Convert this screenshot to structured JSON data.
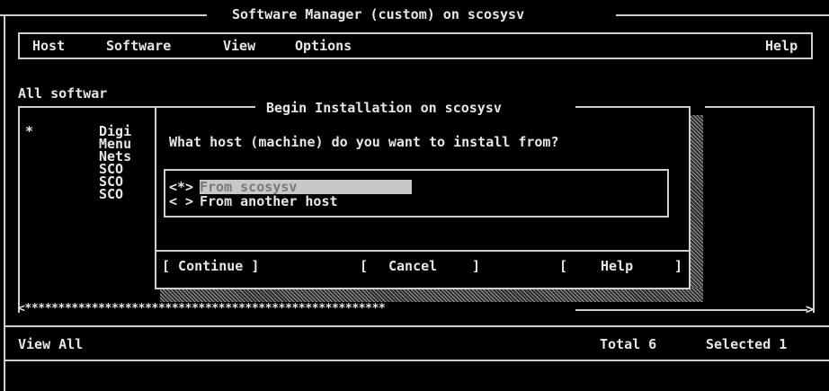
{
  "window": {
    "title": "Software Manager (custom) on scosysv"
  },
  "menubar": {
    "host": "Host",
    "software": "Software",
    "view": "View",
    "options": "Options",
    "help": "Help"
  },
  "main": {
    "section_label": "All softwar",
    "list": [
      {
        "mark": "*",
        "name": "Digi"
      },
      {
        "mark": "",
        "name": "Menu"
      },
      {
        "mark": "",
        "name": "Nets"
      },
      {
        "mark": "",
        "name": "SCO"
      },
      {
        "mark": "",
        "name": "SCO"
      },
      {
        "mark": "",
        "name": "SCO"
      }
    ],
    "scroll_track": "<******************************************************"
  },
  "status": {
    "view": "View All",
    "total": "Total 6",
    "selected": "Selected 1"
  },
  "dialog": {
    "title": "Begin Installation on scosysv",
    "question": "What host (machine) do you want to install from?",
    "options": [
      {
        "marker": "<*>",
        "label": "From scosysv"
      },
      {
        "marker": "< >",
        "label": "From another host"
      }
    ],
    "continue": "[ Continue ]",
    "cancel_open": "[",
    "cancel": "Cancel",
    "cancel_close": "]",
    "help_open": "[",
    "help": "Help",
    "help_close": "]"
  }
}
